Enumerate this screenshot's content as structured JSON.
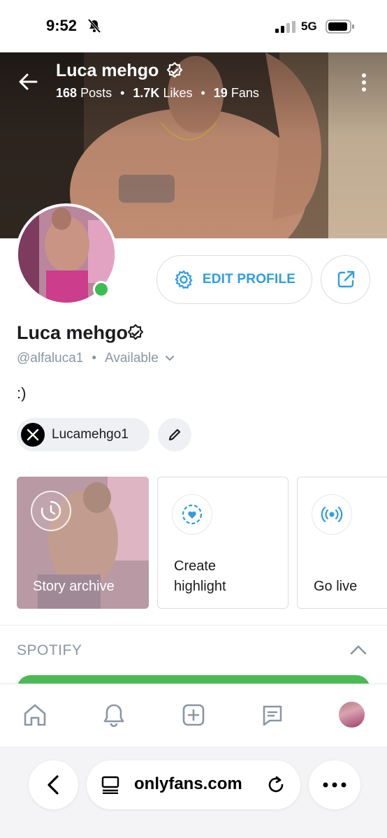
{
  "status_bar": {
    "time": "9:52",
    "network": "5G",
    "bell_icon": "bell-slash-icon",
    "battery_icon": "battery-icon"
  },
  "header": {
    "name": "Luca mehgo",
    "stats": [
      {
        "value": "168",
        "label": "Posts"
      },
      {
        "value": "1.7K",
        "label": "Likes"
      },
      {
        "value": "19",
        "label": "Fans"
      }
    ],
    "back_icon": "arrow-left-icon",
    "more_icon": "more-vertical-icon"
  },
  "actions": {
    "edit_label": "EDIT PROFILE",
    "edit_icon": "gear-icon",
    "share_icon": "share-icon"
  },
  "profile": {
    "name": "Luca mehgo",
    "handle": "@alfaluca1",
    "availability": "Available",
    "bio": ":)",
    "online": true
  },
  "social": {
    "username": "Lucamehgo1",
    "network_icon": "x-logo-icon"
  },
  "highlights": [
    {
      "label": "Story archive",
      "icon": "clock-history-icon"
    },
    {
      "label_line1": "Create",
      "label_line2": "highlight",
      "icon": "heart-plus-icon"
    },
    {
      "label": "Go live",
      "icon": "broadcast-icon"
    }
  ],
  "spotify": {
    "label": "SPOTIFY",
    "toggle_icon": "chevron-up-icon"
  },
  "tabbar": [
    "home-icon",
    "bell-icon",
    "plus-square-icon",
    "message-icon",
    "avatar"
  ],
  "browser": {
    "host": "onlyfans.com"
  },
  "colors": {
    "accent": "#2e9de0",
    "muted": "#8a96a3",
    "online": "#3cbd50",
    "spotify": "#4cba54"
  }
}
